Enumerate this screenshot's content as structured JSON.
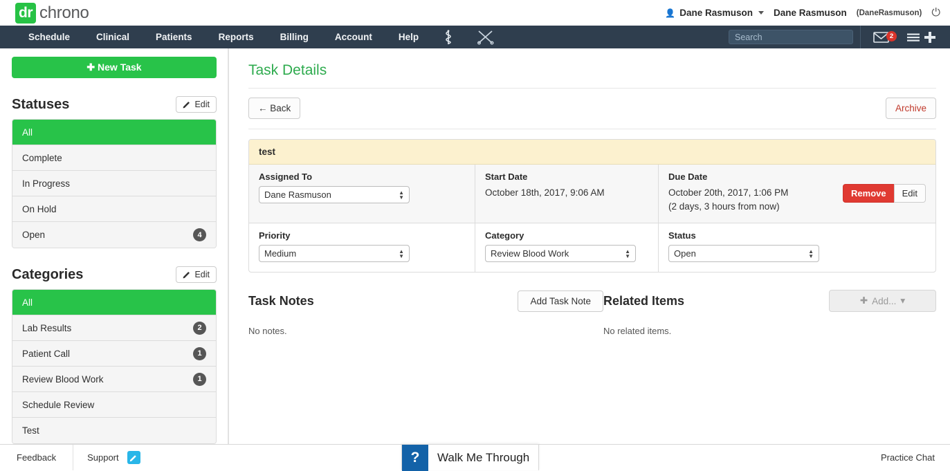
{
  "brand": {
    "logo_prefix": "dr",
    "logo_suffix": "chrono",
    "green": "#28c349",
    "navy": "#2f3e4e"
  },
  "topbar": {
    "user_menu_label": "Dane Rasmuson",
    "user_full_name": "Dane Rasmuson",
    "user_handle": "(DaneRasmuson)",
    "power_icon": "power-icon"
  },
  "nav": {
    "items": [
      {
        "label": "Schedule"
      },
      {
        "label": "Clinical"
      },
      {
        "label": "Patients"
      },
      {
        "label": "Reports"
      },
      {
        "label": "Billing"
      },
      {
        "label": "Account"
      },
      {
        "label": "Help"
      }
    ],
    "icons": [
      {
        "name": "caduceus-icon"
      },
      {
        "name": "crossed-instruments-icon"
      }
    ],
    "search_placeholder": "Search",
    "search_value": "",
    "mail_badge_count": "2",
    "mail_icon": "envelope-icon",
    "menu_icon": "hamburger-icon",
    "add_icon": "plus-icon"
  },
  "sidebar": {
    "new_task_label": "New Task",
    "statuses": {
      "title": "Statuses",
      "edit_label": "Edit",
      "items": [
        {
          "label": "All",
          "count": "",
          "active": true
        },
        {
          "label": "Complete",
          "count": "",
          "active": false
        },
        {
          "label": "In Progress",
          "count": "",
          "active": false
        },
        {
          "label": "On Hold",
          "count": "",
          "active": false
        },
        {
          "label": "Open",
          "count": "4",
          "active": false
        }
      ]
    },
    "categories": {
      "title": "Categories",
      "edit_label": "Edit",
      "items": [
        {
          "label": "All",
          "count": "",
          "active": true
        },
        {
          "label": "Lab Results",
          "count": "2",
          "active": false
        },
        {
          "label": "Patient Call",
          "count": "1",
          "active": false
        },
        {
          "label": "Review Blood Work",
          "count": "1",
          "active": false
        },
        {
          "label": "Schedule Review",
          "count": "",
          "active": false
        },
        {
          "label": "Test",
          "count": "",
          "active": false
        }
      ]
    }
  },
  "main": {
    "page_title": "Task Details",
    "back_label": "← Back",
    "archive_label": "Archive",
    "task": {
      "name": "test",
      "assigned_to_label": "Assigned To",
      "assigned_to_value": "Dane Rasmuson",
      "start_date_label": "Start Date",
      "start_date_value": "October 18th, 2017, 9:06 AM",
      "due_date_label": "Due Date",
      "due_date_value": "October 20th, 2017, 1:06 PM",
      "due_date_relative": "(2 days, 3 hours from now)",
      "remove_label": "Remove",
      "edit_label": "Edit",
      "priority_label": "Priority",
      "priority_value": "Medium",
      "category_label": "Category",
      "category_value": "Review Blood Work",
      "status_label": "Status",
      "status_value": "Open"
    },
    "notes_panel": {
      "title": "Task Notes",
      "add_label": "Add Task Note",
      "empty_text": "No notes."
    },
    "related_panel": {
      "title": "Related Items",
      "add_label": "Add...",
      "empty_text": "No related items."
    }
  },
  "footer": {
    "feedback_label": "Feedback",
    "support_label": "Support",
    "pencil_icon": "pencil-icon",
    "walk_me_through_label": "Walk Me Through",
    "walk_me_through_mark": "?",
    "practice_chat_label": "Practice Chat"
  }
}
